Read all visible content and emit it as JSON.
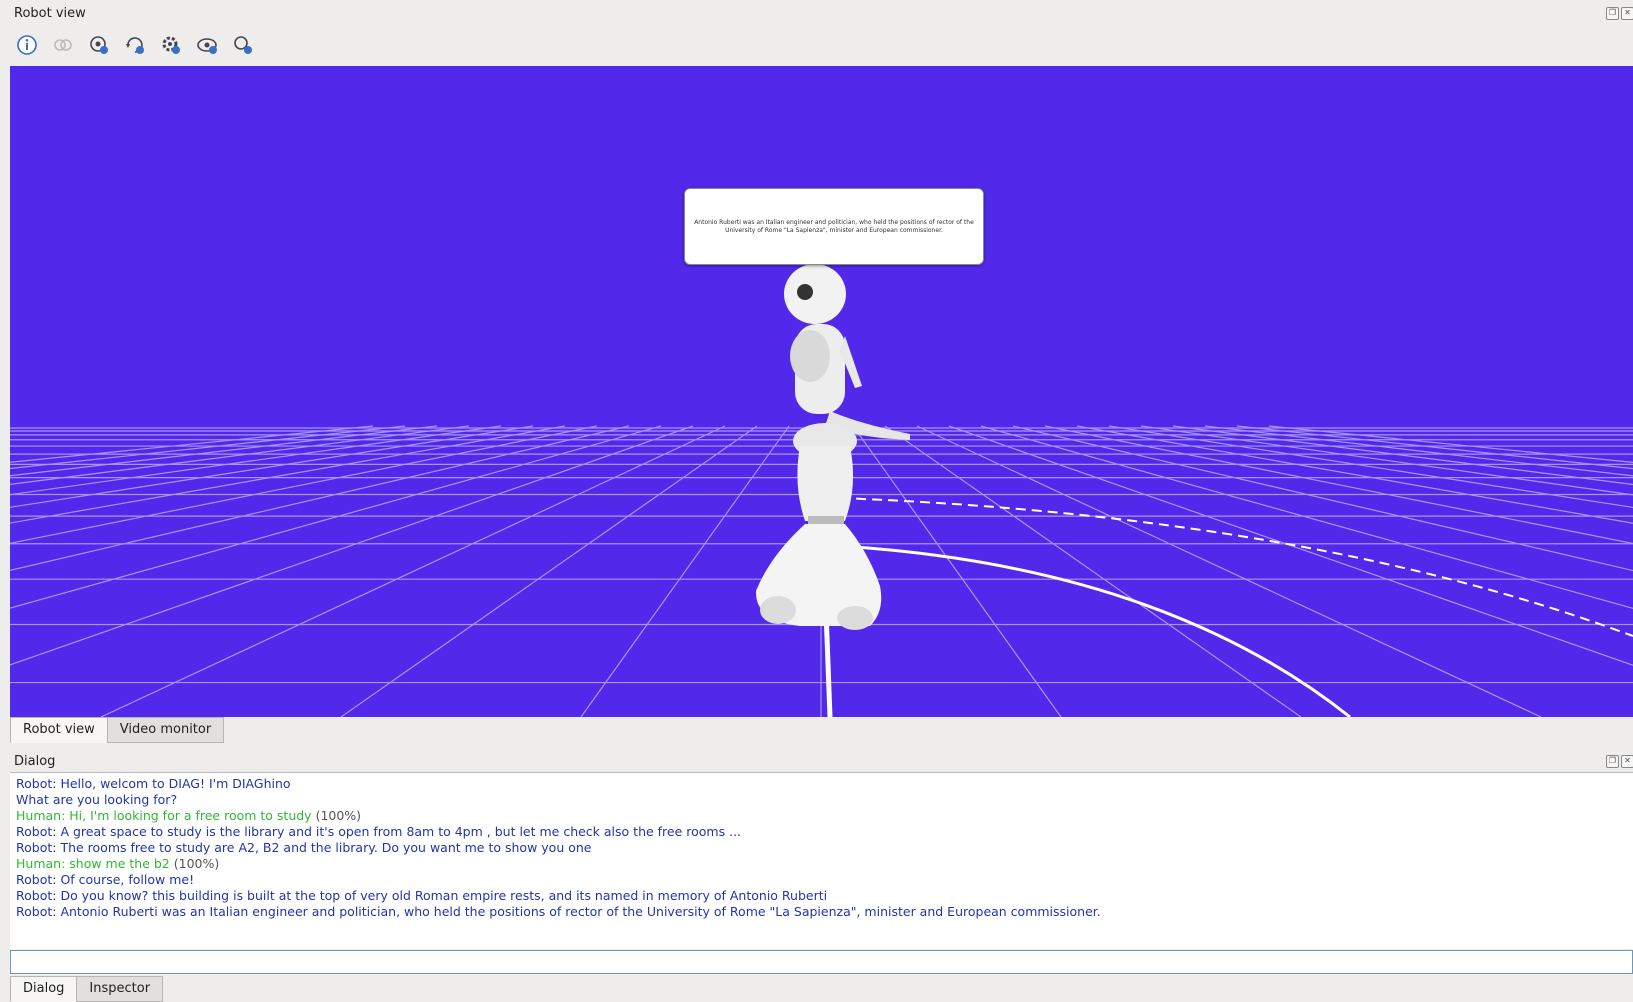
{
  "robot_panel": {
    "title": "Robot view"
  },
  "toolbar": {
    "icons": [
      "info-icon",
      "link-icon",
      "camera-settings-icon",
      "camera-rotate-icon",
      "settings-icon",
      "view-icon",
      "zoom-icon"
    ]
  },
  "scene": {
    "bubble_text": "Antonio Ruberti was an Italian engineer and politician, who held the positions of rector of the University of Rome \"La Sapienza\", minister and European commissioner.",
    "background_color": "#5229ea"
  },
  "view_tabs": [
    "Robot view",
    "Video monitor"
  ],
  "dialog_panel": {
    "title": "Dialog",
    "lines": [
      {
        "speaker": "robot",
        "text": "Robot: Hello, welcom to DIAG! I'm DIAGhino",
        "conf": ""
      },
      {
        "speaker": "robot",
        "text": "What are you looking for?",
        "conf": ""
      },
      {
        "speaker": "human",
        "text": "Human: Hi, I'm looking for a free room to study",
        "conf": "(100%)"
      },
      {
        "speaker": "robot",
        "text": "Robot: A great space to study is the library and it's open from 8am to 4pm , but let me check also the free rooms ...",
        "conf": ""
      },
      {
        "speaker": "robot",
        "text": "Robot: The rooms free to study are A2, B2 and the library. Do you want me to show you one",
        "conf": ""
      },
      {
        "speaker": "human",
        "text": "Human: show me the b2",
        "conf": "(100%)"
      },
      {
        "speaker": "robot",
        "text": "Robot: Of course, follow me!",
        "conf": ""
      },
      {
        "speaker": "robot",
        "text": "Robot: Do you know? this building is built at the top of very old Roman empire rests, and its named in memory of Antonio Ruberti",
        "conf": ""
      },
      {
        "speaker": "robot",
        "text": "Robot: Antonio Ruberti was an Italian engineer and politician, who held the positions of rector of the University of Rome \"La Sapienza\", minister and European commissioner.",
        "conf": ""
      }
    ],
    "input_value": "",
    "input_placeholder": ""
  },
  "dialog_tabs": [
    "Dialog",
    "Inspector"
  ],
  "colors": {
    "robot_text": "#2136a8",
    "human_text": "#35b535"
  }
}
